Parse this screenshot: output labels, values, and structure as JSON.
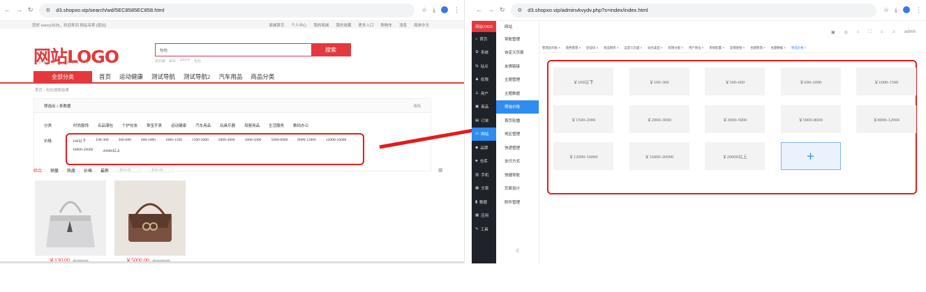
{
  "left": {
    "url": "d3.shopxo.vip/search/wd/5EC8585EC858.html",
    "topbar_left": "您好 nancy2025，欢迎来到 网站名称 [退出]",
    "topbar_links": [
      "商城首页",
      "个人中心",
      "我的商城",
      "我的收藏",
      "更多入口",
      "购物车",
      "消息",
      "简体中文"
    ],
    "logo": "网站LOGO",
    "logo_sub": "企业通用网店全能管理系统",
    "search_value": "包包",
    "search_button": "搜索",
    "hot_words": [
      "连衣裙",
      "帆布",
      "iphone",
      "包包"
    ],
    "all_categories": "全部分类",
    "nav": [
      "首页",
      "运动健康",
      "测试导航",
      "测试导航2",
      "汽车用品",
      "商品分类"
    ],
    "breadcrumb": "首页 › 包包搜索结果",
    "filter_prefix": "筛选出",
    "filter_count": "2",
    "filter_suffix": "条数据",
    "clear": "清除",
    "category_label": "分类",
    "categories": [
      "时尚服饰",
      "名品潮包",
      "个护化妆",
      "珠宝手表",
      "运动健康",
      "汽车用品",
      "玩具乐器",
      "母婴用品",
      "生活服务",
      "数码办公"
    ],
    "price_label": "价格",
    "prices": [
      "100以下",
      "100-300",
      "300-600",
      "600-1000",
      "1000-1500",
      "1500-2000",
      "2000-3000",
      "3000-5000",
      "5000-8000",
      "8000-12000",
      "12000-16000",
      "16000-20000",
      "20000以上"
    ],
    "sort": [
      "综合",
      "销量",
      "热度",
      "价格",
      "最新"
    ],
    "price_min_ph": "最低价格",
    "price_max_ph": "最高价格",
    "products": [
      {
        "price": "￥130.00",
        "original": "￥700.00"
      },
      {
        "price": "￥5000.00",
        "original": "￥6600.00"
      }
    ]
  },
  "right": {
    "url": "d3.shopxo.vip/adminvkvydv.php?s=index/index.html",
    "admin": "admin",
    "side_logo": "网站LOGO",
    "side_items": [
      "首页",
      "系统",
      "站点",
      "权限",
      "用户",
      "商品",
      "订单",
      "网站",
      "品牌",
      "仓库",
      "手机",
      "文章",
      "数据",
      "应用",
      "工具"
    ],
    "sub_header": "网站",
    "sub_items": [
      "导航管理",
      "自定义页面",
      "友情链接",
      "主题管理",
      "主题数据",
      "筛选价格",
      "首页轮播",
      "地区管理",
      "快递管理",
      "支付方式",
      "快捷导航",
      "页面设计",
      "附件管理"
    ],
    "tabs": [
      "管理员列表",
      "角色管理",
      "验证码",
      "商品税率",
      "自定义页面",
      "站点类型",
      "权限分配",
      "用户地址",
      "系统配置",
      "友情链接",
      "主题管理",
      "主题数据",
      "筛选价格"
    ],
    "price_cells": [
      "￥100以下",
      "￥100-300",
      "￥300-600",
      "￥600-1000",
      "￥1000-1500",
      "￥1500-2000",
      "￥2000-3000",
      "￥3000-5000",
      "￥5000-8000",
      "￥8000-12000",
      "￥12000-16000",
      "￥16000-20000",
      "￥20000以上"
    ],
    "add_symbol": "+"
  },
  "colors": {
    "brand": "#e4393c",
    "highlight": "#e41b1b",
    "admin_active": "#2f8cf0",
    "sidebar": "#1f2229"
  }
}
